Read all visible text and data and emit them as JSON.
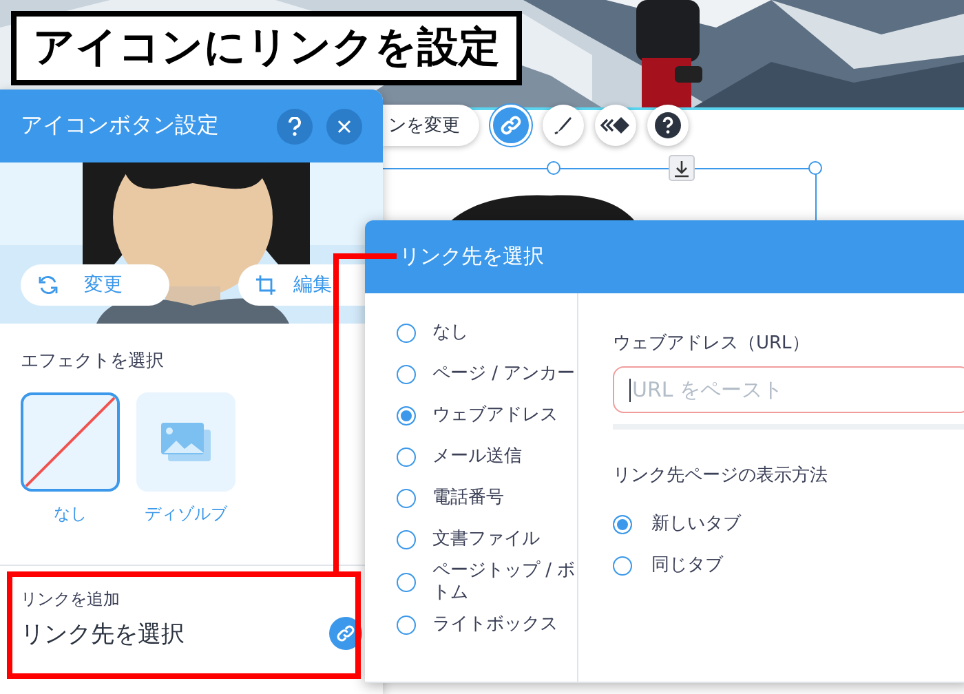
{
  "heading": "アイコンにリンクを設定",
  "toolbar": {
    "partial_button": "ンを変更",
    "buttons": [
      {
        "kind": "link",
        "selected": true
      },
      {
        "kind": "pen",
        "selected": false
      },
      {
        "kind": "animation",
        "selected": false
      },
      {
        "kind": "help",
        "selected": false
      }
    ]
  },
  "settings_panel": {
    "title": "アイコンボタン設定",
    "image_buttons": [
      {
        "kind": "change",
        "label": "変更"
      },
      {
        "kind": "crop",
        "label": "編集"
      }
    ],
    "effect_label": "エフェクトを選択",
    "effects": [
      {
        "kind": "none",
        "label": "なし",
        "selected": true
      },
      {
        "kind": "dissolve",
        "label": "ディゾルブ",
        "selected": false
      }
    ],
    "link_label": "リンクを追加",
    "link_value": "リンク先を選択"
  },
  "link_dialog": {
    "title": "リンク先を選択",
    "options": [
      {
        "label": "なし",
        "selected": false
      },
      {
        "label": "ページ / アンカー",
        "selected": false
      },
      {
        "label": "ウェブアドレス",
        "selected": true
      },
      {
        "label": "メール送信",
        "selected": false
      },
      {
        "label": "電話番号",
        "selected": false
      },
      {
        "label": "文書ファイル",
        "selected": false
      },
      {
        "label": "ページトップ / ボトム",
        "selected": false
      },
      {
        "label": "ライトボックス",
        "selected": false
      }
    ],
    "url_label": "ウェブアドレス（URL）",
    "url_placeholder": "URL をペースト",
    "open_label": "リンク先ページの表示方法",
    "open_options": [
      {
        "label": "新しいタブ",
        "selected": true
      },
      {
        "label": "同じタブ",
        "selected": false
      }
    ]
  }
}
